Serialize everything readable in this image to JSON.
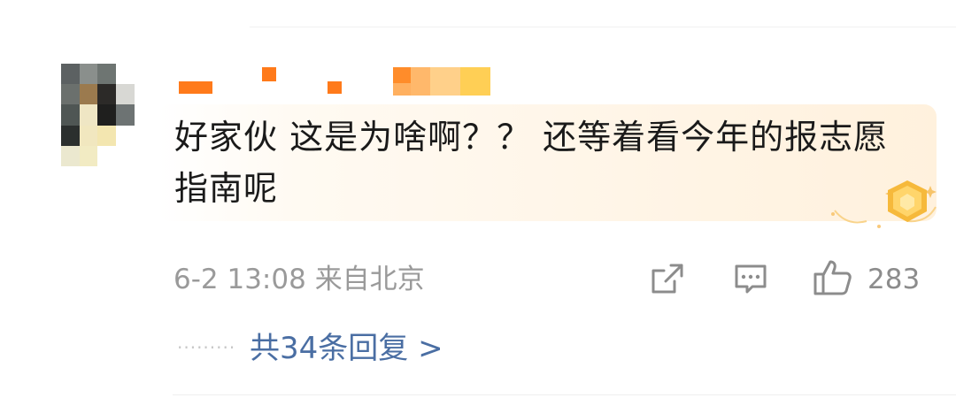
{
  "comment": {
    "text": "好家伙 这是为啥啊？？ 还等着看今年的报志愿指南呢",
    "timestamp": "6-2 13:08",
    "location": "来自北京",
    "likes": "283"
  },
  "replies": {
    "dots": "·········",
    "label": "共34条回复 >"
  },
  "icons": {
    "share": "share-icon",
    "comment": "comment-icon",
    "like": "thumbs-up-icon",
    "badge": "fan-badge-icon"
  },
  "colors": {
    "text_primary": "#1a1a1a",
    "meta_gray": "#9a9a9a",
    "link_blue": "#4a6ea3",
    "bubble_tint": "#fff5e7",
    "badge_gold": "#f6b93b"
  }
}
